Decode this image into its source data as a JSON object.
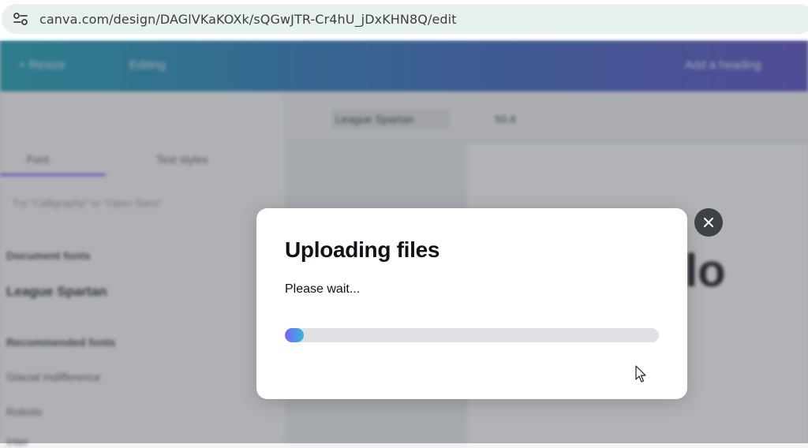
{
  "browser": {
    "url": "canva.com/design/DAGlVKaKOXk/sQGwJTR-Cr4hU_jDxKHN8Q/edit"
  },
  "background": {
    "topbar": {
      "items": [
        "+ Resize",
        "Editing",
        "Add a heading"
      ]
    },
    "panel": {
      "tabs": [
        "Font",
        "Text styles"
      ],
      "search_placeholder": "Try \"Calligraphy\" or \"Open Sans\"",
      "section_document": "Document fonts",
      "current_font": "League Spartan",
      "section_recommended": "Recommended fonts",
      "fonts": [
        "Glacial Indifference",
        "Roboto",
        "Inter"
      ]
    },
    "toolbar": {
      "font_name": "League Spartan",
      "font_size": "50.6"
    },
    "canvas_text": "lo"
  },
  "modal": {
    "title": "Uploading files",
    "subtitle": "Please wait...",
    "progress": 0.05
  },
  "icons": {
    "close": "close-icon",
    "site_settings": "site-settings-icon",
    "cursor": "mouse-cursor-icon"
  },
  "colors": {
    "progress_start": "#7b61ff",
    "progress_end": "#31b9d4",
    "close_bg": "#3e4248"
  }
}
